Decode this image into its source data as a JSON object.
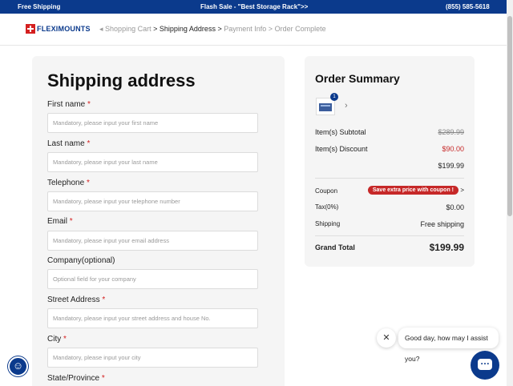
{
  "topbar": {
    "shipping": "Free Shipping",
    "sale": "Flash Sale - \"Best Storage Rack\">>",
    "phone": "(855) 585-5618"
  },
  "header": {
    "logo_text": "FLEXIMOUNTS",
    "breadcrumb": {
      "back_arrow": "◂",
      "cart": "Shopping Cart",
      "sep": ">",
      "address": "Shipping Address",
      "payment": "Payment Info",
      "complete": "Order Complete"
    }
  },
  "form": {
    "title": "Shipping address",
    "required_mark": "*",
    "fields": [
      {
        "label": "First name",
        "placeholder": "Mandatory, please input your first name"
      },
      {
        "label": "Last name",
        "placeholder": "Mandatory, please input your last name"
      },
      {
        "label": "Telephone",
        "placeholder": "Mandatory, please input your telephone number"
      },
      {
        "label": "Email",
        "placeholder": "Mandatory, please input your email address"
      },
      {
        "label": "Company(optional)",
        "placeholder": "Optional field for your company"
      },
      {
        "label": "Street Address",
        "placeholder": "Mandatory, please input your street address and house No."
      },
      {
        "label": "City",
        "placeholder": "Mandatory, please input your city"
      },
      {
        "label": "State/Province",
        "placeholder": ""
      }
    ]
  },
  "summary": {
    "title": "Order Summary",
    "item_qty": "1",
    "chevron": "›",
    "subtotal_label": "Item(s) Subtotal",
    "subtotal_value": "$289.99",
    "discount_label": "Item(s) Discount",
    "discount_value": "$90.00",
    "net_value": "$199.99",
    "coupon_label": "Coupon",
    "coupon_button": "Save extra price with coupon !",
    "coupon_chevron": ">",
    "tax_label": "Tax(0%)",
    "tax_value": "$0.00",
    "shipping_label": "Shipping",
    "shipping_value": "Free shipping",
    "grand_label": "Grand Total",
    "grand_value": "$199.99"
  },
  "chat": {
    "greeting": "Good day, how may I assist you?",
    "close": "✕"
  },
  "a11y": {
    "icon": "☺"
  },
  "colors": {
    "brand": "#0b3a8c",
    "accent_red": "#c62828",
    "card_bg": "#f5f5f5"
  }
}
